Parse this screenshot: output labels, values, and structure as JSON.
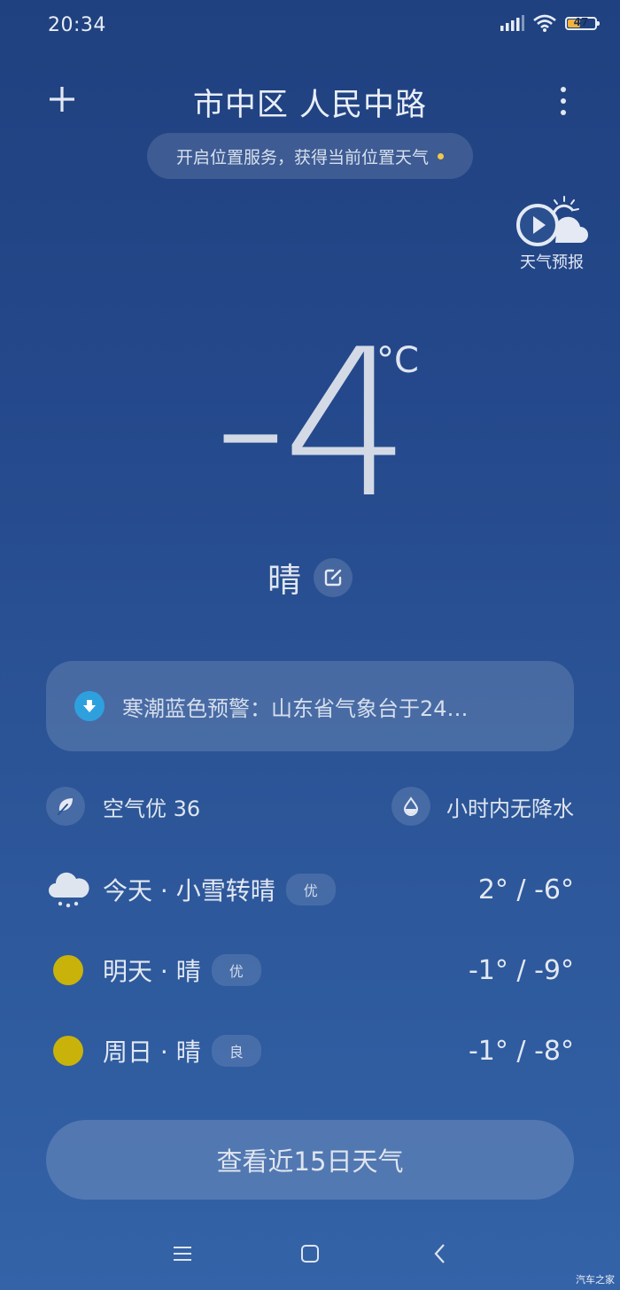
{
  "status_bar": {
    "time": "20:34",
    "battery_level": "47",
    "battery_fraction": 0.47,
    "icons": [
      "signal-icon",
      "wifi-icon",
      "battery-icon"
    ]
  },
  "header": {
    "city": "市中区 人民中路",
    "location_prompt": "开启位置服务，获得当前位置天气",
    "forecast_video_label": "天气预报"
  },
  "current": {
    "temperature": "-4",
    "unit": "°C",
    "condition": "晴"
  },
  "alert": {
    "text": "寒潮蓝色预警：山东省气象台于24…",
    "color": "#2fa0de"
  },
  "air": {
    "aqi_text": "空气优 36"
  },
  "precip": {
    "text": "小时内无降水"
  },
  "daily": [
    {
      "label": "今天 · 小雪转晴",
      "aqi": "优",
      "temps": "2° / -6°",
      "icon": "snow-cloud-icon"
    },
    {
      "label": "明天 · 晴",
      "aqi": "优",
      "temps": "-1° / -9°",
      "icon": "sun-icon"
    },
    {
      "label": "周日 · 晴",
      "aqi": "良",
      "temps": "-1° / -8°",
      "icon": "sun-icon"
    }
  ],
  "buttons": {
    "fifteen_day": "查看近15日天气"
  },
  "colors": {
    "background_top": "#20417f",
    "background_bottom": "#3463a8",
    "sun": "#c9b30b",
    "battery": "#f0b43c"
  },
  "watermark": "汽车之家"
}
